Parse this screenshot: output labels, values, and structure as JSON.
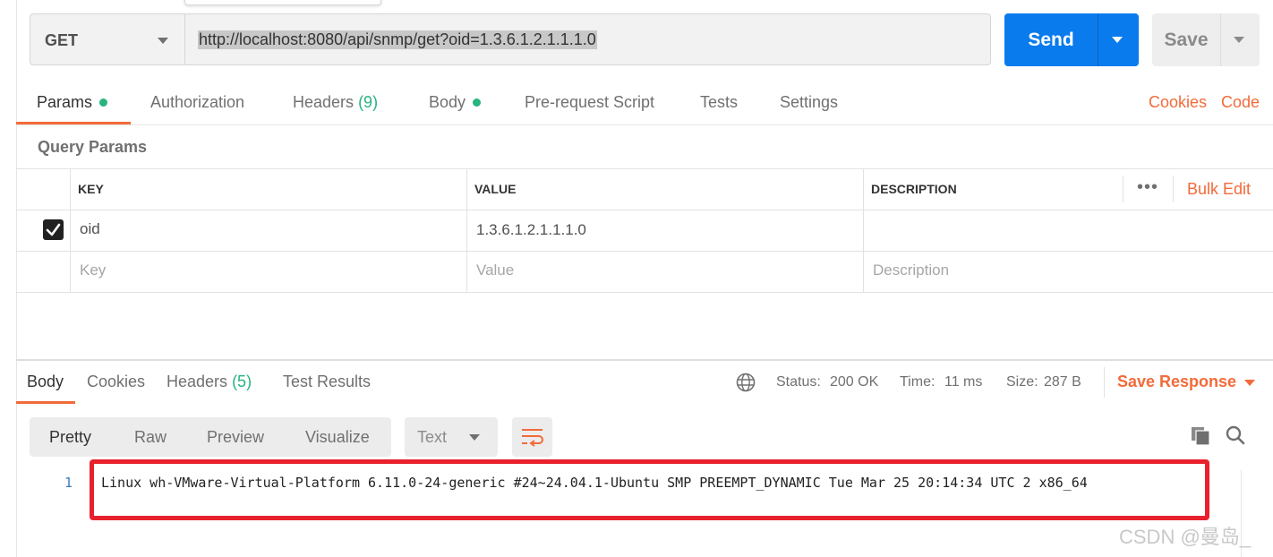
{
  "request": {
    "method": "GET",
    "url": "http://localhost:8080/api/snmp/get?oid=1.3.6.1.2.1.1.1.0",
    "send_label": "Send",
    "save_label": "Save"
  },
  "request_tabs": [
    {
      "label": "Params",
      "indicator": "dot",
      "active": true
    },
    {
      "label": "Authorization"
    },
    {
      "label": "Headers",
      "count": "(9)"
    },
    {
      "label": "Body",
      "indicator": "dot"
    },
    {
      "label": "Pre-request Script"
    },
    {
      "label": "Tests"
    },
    {
      "label": "Settings"
    }
  ],
  "links": {
    "cookies": "Cookies",
    "code": "Code"
  },
  "query_params": {
    "title": "Query Params",
    "headers": {
      "key": "KEY",
      "value": "VALUE",
      "description": "DESCRIPTION"
    },
    "more": "•••",
    "bulk_edit": "Bulk Edit",
    "rows": [
      {
        "checked": true,
        "key": "oid",
        "value": "1.3.6.1.2.1.1.1.0",
        "description": ""
      }
    ],
    "placeholders": {
      "key": "Key",
      "value": "Value",
      "description": "Description"
    }
  },
  "response": {
    "tabs": [
      {
        "label": "Body",
        "active": true
      },
      {
        "label": "Cookies"
      },
      {
        "label": "Headers",
        "count": "(5)"
      },
      {
        "label": "Test Results"
      }
    ],
    "status_label": "Status:",
    "status_value": "200 OK",
    "time_label": "Time:",
    "time_value": "11 ms",
    "size_label": "Size:",
    "size_value": "287 B",
    "save_response": "Save Response",
    "view_modes": [
      "Pretty",
      "Raw",
      "Preview",
      "Visualize"
    ],
    "format": "Text",
    "body_lines": [
      {
        "number": "1",
        "text": "Linux wh-VMware-Virtual-Platform 6.11.0-24-generic #24~24.04.1-Ubuntu SMP PREEMPT_DYNAMIC Tue Mar 25 20:14:34 UTC 2 x86_64"
      }
    ]
  },
  "watermark": "CSDN @曼岛_",
  "colors": {
    "accent": "#f26b3a",
    "send": "#097bed",
    "success": "#26b47f",
    "highlight_box": "#e8212d"
  },
  "icons": [
    "dropdown-caret-icon",
    "checkbox-checked-icon",
    "globe-icon",
    "wrap-lines-icon",
    "copy-icon",
    "search-icon"
  ]
}
